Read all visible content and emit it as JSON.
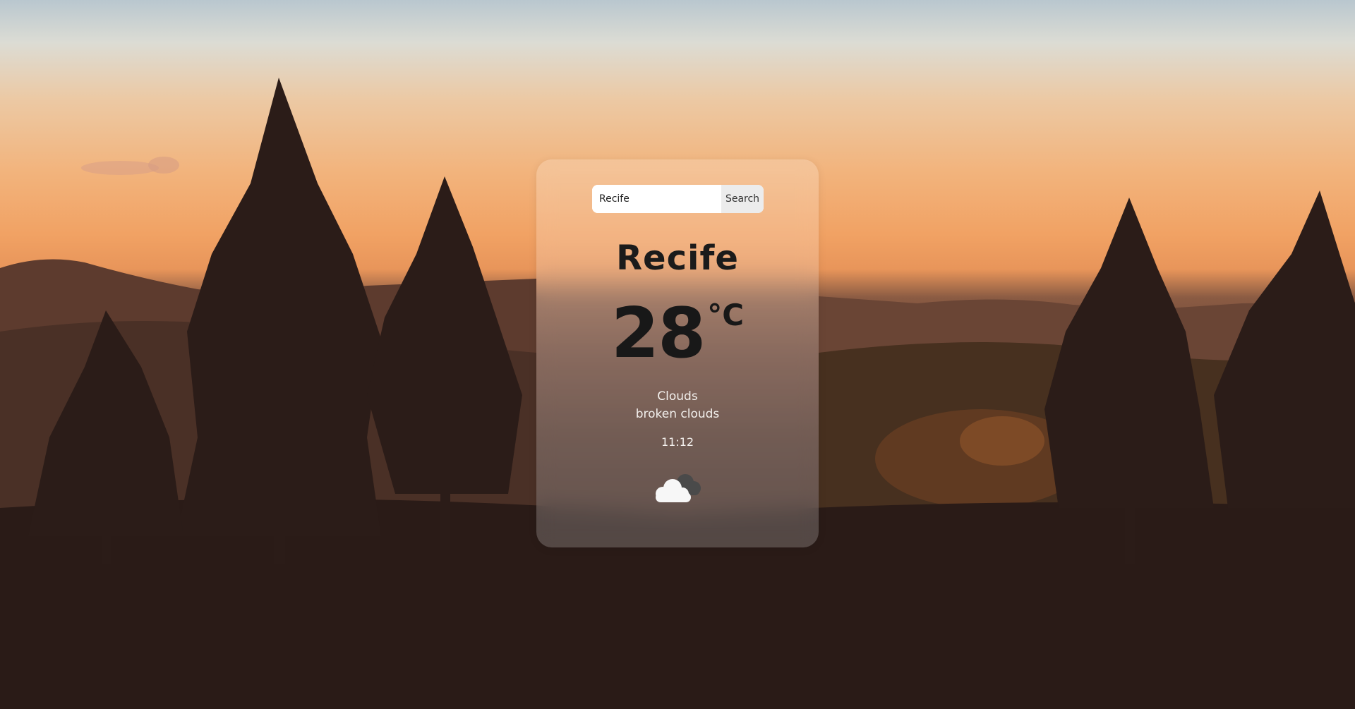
{
  "search": {
    "value": "Recife",
    "button_label": "Search"
  },
  "weather": {
    "city": "Recife",
    "temperature": "28",
    "unit": "°C",
    "main": "Clouds",
    "description": "broken clouds",
    "time": "11:12",
    "icon": "broken-clouds-icon"
  }
}
